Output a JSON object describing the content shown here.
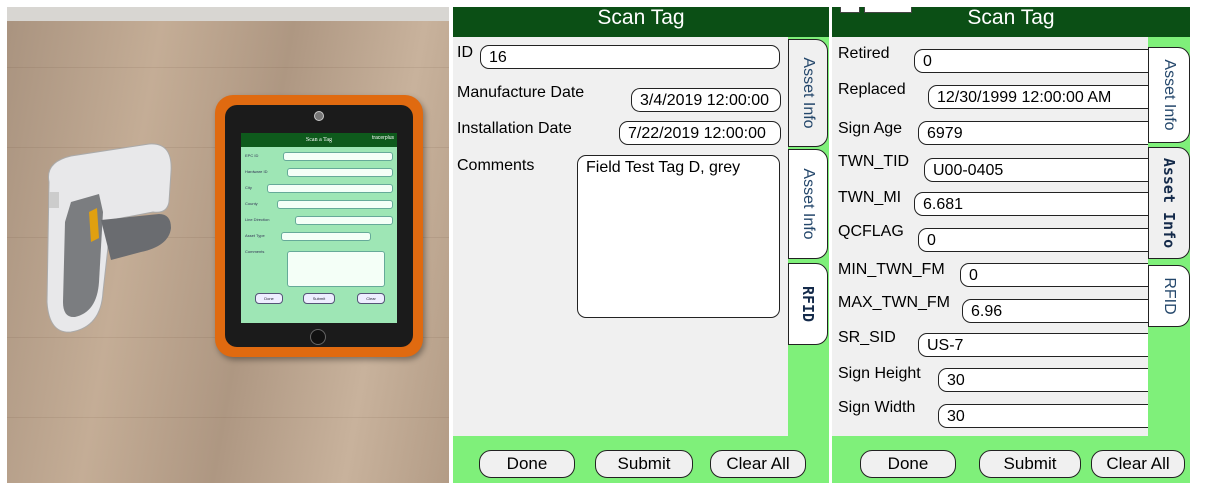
{
  "photo": {
    "mini_screen": {
      "title": "Scan a Tag",
      "logo": "tracerplus",
      "rows": [
        "EPC ID",
        "Hardware ID",
        "City",
        "County",
        "Line Direction",
        "Asset Type",
        "Comments"
      ],
      "buttons": [
        "Done",
        "Submit",
        "Clear"
      ]
    }
  },
  "panel1": {
    "title": "Scan Tag",
    "fields": [
      {
        "label": "ID",
        "value": "16"
      },
      {
        "label": "Manufacture Date",
        "value": "3/4/2019 12:00:00"
      },
      {
        "label": "Installation Date",
        "value": "7/22/2019 12:00:00"
      },
      {
        "label": "Comments",
        "value": "Field Test Tag D, grey"
      }
    ],
    "tabs": [
      "Asset Info",
      "Asset Info",
      "RFID"
    ],
    "buttons": {
      "done": "Done",
      "submit": "Submit",
      "clear": "Clear All"
    }
  },
  "panel2": {
    "title": "Scan Tag",
    "fields": [
      {
        "label": "Retired",
        "value": "0"
      },
      {
        "label": "Replaced",
        "value": "12/30/1999 12:00:00 AM"
      },
      {
        "label": "Sign Age",
        "value": "6979"
      },
      {
        "label": "TWN_TID",
        "value": "U00-0405"
      },
      {
        "label": "TWN_MI",
        "value": "6.681"
      },
      {
        "label": "QCFLAG",
        "value": "0"
      },
      {
        "label": "MIN_TWN_FM",
        "value": "0"
      },
      {
        "label": "MAX_TWN_FM",
        "value": "6.96"
      },
      {
        "label": "SR_SID",
        "value": "US-7"
      },
      {
        "label": "Sign Height",
        "value": "30"
      },
      {
        "label": "Sign Width",
        "value": "30"
      }
    ],
    "tabs": [
      "Asset Info",
      "Asset Info",
      "RFID"
    ],
    "buttons": {
      "done": "Done",
      "submit": "Submit",
      "clear": "Clear All"
    }
  },
  "colors": {
    "title_bar": "#0b4f15",
    "tab_strip": "#7ff07a",
    "content_bg": "#f0f0f0"
  }
}
